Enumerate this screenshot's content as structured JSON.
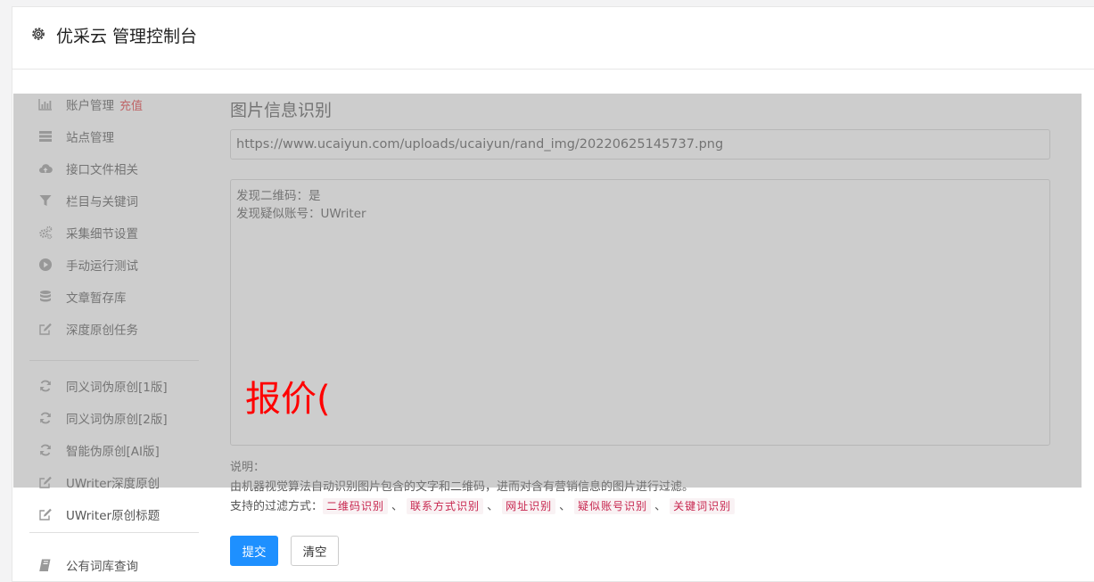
{
  "header": {
    "title": "优采云 管理控制台",
    "icon": "gear-icon"
  },
  "sidebar": {
    "items": [
      {
        "label": "账户管理",
        "extra": "充值",
        "icon": "bar-chart-icon"
      },
      {
        "label": "站点管理",
        "icon": "server-icon"
      },
      {
        "label": "接口文件相关",
        "icon": "cloud-upload-icon"
      },
      {
        "label": "栏目与关键词",
        "icon": "filter-icon"
      },
      {
        "label": "采集细节设置",
        "icon": "gears-icon"
      },
      {
        "label": "手动运行测试",
        "icon": "play-circle-icon"
      },
      {
        "label": "文章暂存库",
        "icon": "database-icon"
      },
      {
        "label": "深度原创任务",
        "icon": "edit-icon"
      },
      {
        "label": "同义词伪原创[1版]",
        "icon": "refresh-icon"
      },
      {
        "label": "同义词伪原创[2版]",
        "icon": "refresh-icon"
      },
      {
        "label": "智能伪原创[AI版]",
        "icon": "refresh-icon"
      },
      {
        "label": "UWriter深度原创",
        "icon": "edit-icon"
      },
      {
        "label": "UWriter原创标题",
        "icon": "edit-icon"
      },
      {
        "label": "公有词库查询",
        "icon": "book-icon"
      }
    ]
  },
  "main": {
    "section_title": "图片信息识别",
    "url_value": "https://www.ucaiyun.com/uploads/ucaiyun/rand_img/20220625145737.png",
    "result_lines": [
      "发现二维码：是",
      "发现疑似账号：UWriter"
    ],
    "notes_heading": "说明：",
    "notes_text": "由机器视觉算法自动识别图片包含的文字和二维码，进而对含有营销信息的图片进行过滤。",
    "methods_label": "支持的过滤方式：",
    "methods": [
      "二维码识别",
      "联系方式识别",
      "网址识别",
      "疑似账号识别",
      "关键词识别"
    ],
    "method_separator": "、",
    "submit_label": "提交",
    "clear_label": "清空"
  },
  "overlay": {
    "watermark": "报价("
  },
  "colors": {
    "accent": "#1e90ff",
    "recharge": "#e4393c",
    "tag_text": "#c7254e",
    "tag_bg": "#f9f2f4",
    "watermark": "#ff0000"
  }
}
